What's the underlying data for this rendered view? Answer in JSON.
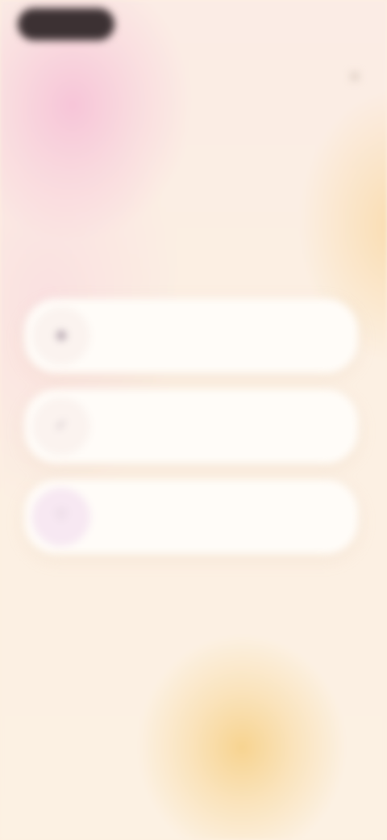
{
  "header": {
    "back_label": "",
    "close_icon": "close-icon"
  },
  "main": {
    "heading": "",
    "subheading": ""
  },
  "options": [
    {
      "icon": "chat-icon",
      "title": "",
      "description": ""
    },
    {
      "icon": "check-icon",
      "title": "",
      "description": ""
    },
    {
      "icon": "heart-icon",
      "title": "",
      "description": ""
    }
  ],
  "colors": {
    "background": "#fcefe0",
    "pink_glow": "#f6bed6",
    "peach_glow": "#f7d28c",
    "pill": "#3c3133",
    "heading_text": "#4a3b3c",
    "card": "#fffcf8"
  }
}
